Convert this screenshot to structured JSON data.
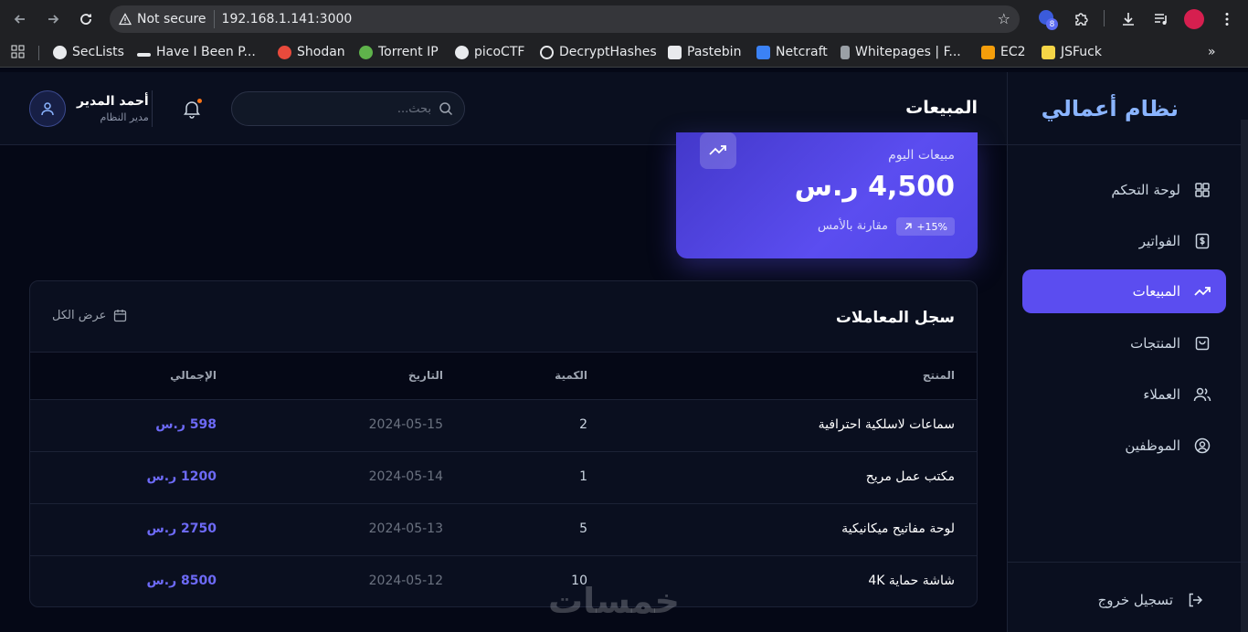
{
  "browser": {
    "security_label": "Not secure",
    "url": "192.168.1.141:3000",
    "extension_badge": "8",
    "bookmarks": [
      {
        "label": "SecLists",
        "color": "#e8eaed"
      },
      {
        "label": "Have I Been P...",
        "color": "#e8eaed"
      },
      {
        "label": "Shodan",
        "color": "#e84a3c"
      },
      {
        "label": "Torrent IP",
        "color": "#5fb34b"
      },
      {
        "label": "picoCTF",
        "color": "#e8eaed"
      },
      {
        "label": "DecryptHashes",
        "color": "#e8eaed"
      },
      {
        "label": "Pastebin",
        "color": "#e8eaed"
      },
      {
        "label": "Netcraft",
        "color": "#3b82f6"
      },
      {
        "label": "Whitepages | F...",
        "color": "#9aa0a6"
      },
      {
        "label": "EC2",
        "color": "#f59e0b"
      },
      {
        "label": "JSFuck",
        "color": "#f5d547"
      }
    ]
  },
  "sidebar": {
    "brand": "نظام أعمالي",
    "items": [
      {
        "label": "لوحة التحكم",
        "icon": "grid-icon"
      },
      {
        "label": "الفواتير",
        "icon": "dollar-icon"
      },
      {
        "label": "المبيعات",
        "icon": "trending-up-icon",
        "active": true
      },
      {
        "label": "المنتجات",
        "icon": "bag-icon"
      },
      {
        "label": "العملاء",
        "icon": "users-icon"
      },
      {
        "label": "الموظفين",
        "icon": "user-circle-icon"
      }
    ],
    "logout": "تسجيل خروج"
  },
  "header": {
    "title": "المبيعات",
    "search_placeholder": "بحث...",
    "user_name": "أحمد المدير",
    "user_role": "مدير النظام"
  },
  "sales_card": {
    "label": "مبيعات اليوم",
    "value": "4,500 ر.س",
    "badge": "+15%",
    "compare": "مقارنة بالأمس"
  },
  "transactions": {
    "title": "سجل المعاملات",
    "view_all": "عرض الكل",
    "columns": [
      "المنتج",
      "الكمية",
      "التاريخ",
      "الإجمالي"
    ],
    "rows": [
      {
        "product": "سماعات لاسلكية احترافية",
        "qty": "2",
        "date": "2024-05-15",
        "total": "598 ر.س"
      },
      {
        "product": "مكتب عمل مريح",
        "qty": "1",
        "date": "2024-05-14",
        "total": "1200 ر.س"
      },
      {
        "product": "لوحة مفاتيح ميكانيكية",
        "qty": "5",
        "date": "2024-05-13",
        "total": "2750 ر.س"
      },
      {
        "product": "شاشة حماية 4K",
        "qty": "10",
        "date": "2024-05-12",
        "total": "8500 ر.س"
      }
    ]
  },
  "watermark": "خمسات",
  "colors": {
    "accent": "#5b4df0",
    "total_text": "#6d6af7",
    "background": "#050816",
    "panel": "#0a0f1f"
  }
}
